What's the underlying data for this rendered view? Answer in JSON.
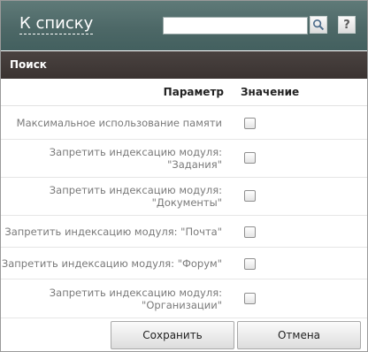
{
  "topbar": {
    "back_label": "К списку",
    "search_value": "",
    "search_placeholder": "",
    "help_label": "?"
  },
  "section": {
    "title": "Поиск"
  },
  "table": {
    "col_param": "Параметр",
    "col_value": "Значение",
    "rows": [
      {
        "line1": "Максимальное использование памяти",
        "line2": "",
        "checked": false
      },
      {
        "line1": "Запретить индексацию модуля:",
        "line2": "\"Задания\"",
        "checked": false
      },
      {
        "line1": "Запретить индексацию модуля:",
        "line2": "\"Документы\"",
        "checked": false
      },
      {
        "line1": "Запретить индексацию модуля: \"Почта\"",
        "line2": "",
        "checked": false
      },
      {
        "line1": "Запретить индексацию модуля: \"Форум\"",
        "line2": "",
        "checked": false
      },
      {
        "line1": "Запретить индексацию модуля:",
        "line2": "\"Организации\"",
        "checked": false
      }
    ]
  },
  "footer": {
    "save_label": "Сохранить",
    "cancel_label": "Отмена"
  }
}
